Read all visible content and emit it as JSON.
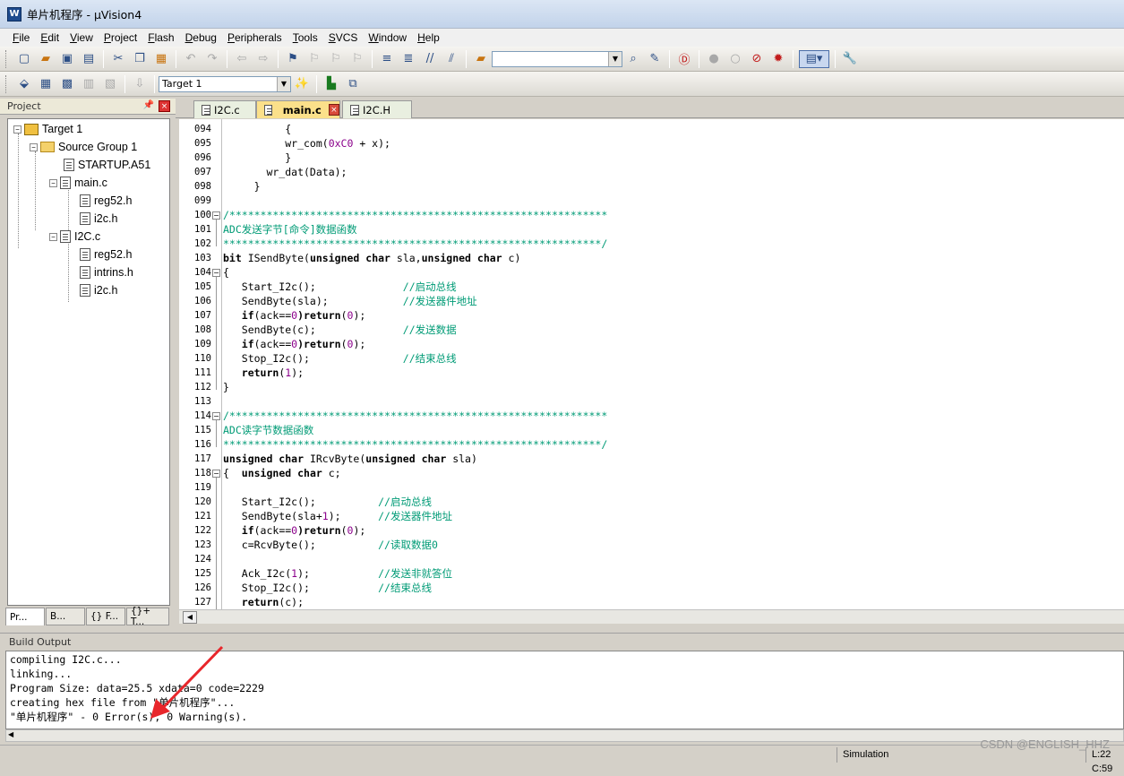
{
  "window": {
    "title": "单片机程序  - µVision4",
    "icon_letter": "W"
  },
  "menu": [
    "File",
    "Edit",
    "View",
    "Project",
    "Flash",
    "Debug",
    "Peripherals",
    "Tools",
    "SVCS",
    "Window",
    "Help"
  ],
  "toolbar": {
    "find_combo_value": "",
    "target_combo_value": "Target 1"
  },
  "project_panel": {
    "title": "Project",
    "tree": {
      "target": "Target 1",
      "group": "Source Group 1",
      "startup": "STARTUP.A51",
      "main_c": "main.c",
      "main_reg52": "reg52.h",
      "main_i2c": "i2c.h",
      "i2c_c": "I2C.c",
      "i2c_reg52": "reg52.h",
      "i2c_intrins": "intrins.h",
      "i2c_i2c": "i2c.h"
    },
    "tabs": [
      "Pr...",
      "B...",
      "{} F...",
      "{}+ T..."
    ]
  },
  "editor_tabs": [
    "I2C.c",
    "main.c",
    "I2C.H"
  ],
  "active_tab": "main.c",
  "code": {
    "l094": "094",
    "l095": "095",
    "l096": "096",
    "l097": "097",
    "l098": "098",
    "l099": "099",
    "l100": "100",
    "l101": "101",
    "l102": "102",
    "l103": "103",
    "l104": "104",
    "l105": "105",
    "l106": "106",
    "l107": "107",
    "l108": "108",
    "l109": "109",
    "l110": "110",
    "l111": "111",
    "l112": "112",
    "l113": "113",
    "l114": "114",
    "l115": "115",
    "l116": "116",
    "l117": "117",
    "l118": "118",
    "l119": "119",
    "l120": "120",
    "l121": "121",
    "l122": "122",
    "l123": "123",
    "l124": "124",
    "l125": "125",
    "l126": "126",
    "l127": "127",
    "t094": "          {",
    "t095a": "          wr_com(",
    "t095n": "0xC0",
    "t095b": " + x);",
    "t096": "          }",
    "t097": "       wr_dat(Data);",
    "t098": "     }",
    "t100": "/*************************************************************",
    "t101": "ADC发送字节[命令]数据函数",
    "t102": "*************************************************************/",
    "t103k1": "bit",
    "t103a": " ISendByte(",
    "t103k2": "unsigned char",
    "t103b": " sla,",
    "t103k3": "unsigned char",
    "t103c": " c)",
    "t104": "{",
    "t105a": "   Start_I2c();              ",
    "t105c": "//启动总线",
    "t106a": "   SendByte(sla);            ",
    "t106c": "//发送器件地址",
    "t107k1": "   if",
    "t107a": "(ack==",
    "t107n": "0",
    "t107k2": ")return",
    "t107b": "(",
    "t107n2": "0",
    "t107c": ");",
    "t108a": "   SendByte(c);              ",
    "t108c": "//发送数据",
    "t109k1": "   if",
    "t109a": "(ack==",
    "t109n": "0",
    "t109k2": ")return",
    "t109b": "(",
    "t109n2": "0",
    "t109c": ");",
    "t110a": "   Stop_I2c();               ",
    "t110c": "//结束总线",
    "t111k": "   return",
    "t111a": "(",
    "t111n": "1",
    "t111b": ");",
    "t112": "}",
    "t114": "/*************************************************************",
    "t115": "ADC读字节数据函数",
    "t116": "*************************************************************/",
    "t117k1": "unsigned char",
    "t117a": " IRcvByte(",
    "t117k2": "unsigned char",
    "t117b": " sla)",
    "t118a": "{  ",
    "t118k": "unsigned char",
    "t118b": " c;",
    "t120a": "   Start_I2c();          ",
    "t120c": "//启动总线",
    "t121a": "   SendByte(sla+",
    "t121n": "1",
    "t121b": ");      ",
    "t121c": "//发送器件地址",
    "t122k1": "   if",
    "t122a": "(ack==",
    "t122n": "0",
    "t122k2": ")return",
    "t122b": "(",
    "t122n2": "0",
    "t122c": ");",
    "t123a": "   c=RcvByte();          ",
    "t123c": "//读取数据0",
    "t125a": "   Ack_I2c(",
    "t125n": "1",
    "t125b": ");           ",
    "t125c": "//发送非就答位",
    "t126a": "   Stop_I2c();           ",
    "t126c": "//结束总线",
    "t127k": "   return",
    "t127a": "(c);"
  },
  "build_output": {
    "title": "Build Output",
    "lines": [
      "compiling I2C.c...",
      "linking...",
      "Program Size: data=25.5 xdata=0 code=2229",
      "creating hex file from \"单片机程序\"...",
      "\"单片机程序\" - 0 Error(s), 0 Warning(s)."
    ]
  },
  "status": {
    "mode": "Simulation",
    "position": "L:22 C:59"
  },
  "watermark": "CSDN @ENGLISH_HHZ",
  "colors": {
    "keyword": "#000000",
    "number": "#8b008b",
    "comment": "#009b76",
    "annotation_arrow": "#e8262b"
  }
}
